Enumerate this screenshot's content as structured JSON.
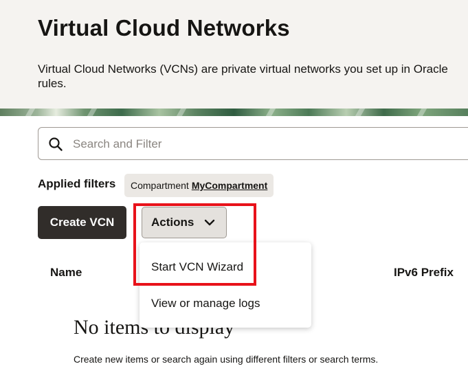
{
  "header": {
    "title": "Virtual Cloud Networks",
    "description": "Virtual Cloud Networks (VCNs) are private virtual networks you set up in Oracle rules."
  },
  "search": {
    "placeholder": "Search and Filter",
    "icon": "search-icon"
  },
  "filters": {
    "label": "Applied filters",
    "chip_key": "Compartment",
    "chip_value": "MyCompartment"
  },
  "toolbar": {
    "create_label": "Create VCN",
    "actions_label": "Actions"
  },
  "table": {
    "columns": [
      "Name",
      "IPv6 Prefix"
    ]
  },
  "actions_menu": {
    "items": [
      "Start VCN Wizard",
      "View or manage logs"
    ]
  },
  "empty_state": {
    "title": "No items to display",
    "message": "Create new items or search again using different filters or search terms."
  },
  "colors": {
    "primary_button": "#312d2a",
    "highlight": "#e8121a",
    "header_bg": "#f5f3f0"
  }
}
